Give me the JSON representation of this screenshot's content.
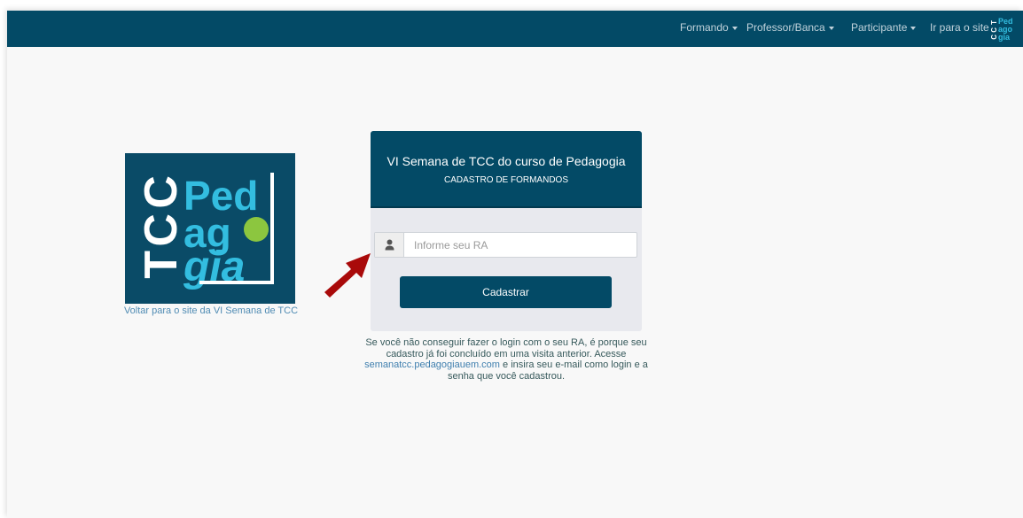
{
  "navbar": {
    "items": [
      {
        "label": "Formando",
        "has_dropdown": true
      },
      {
        "label": "Professor/Banca",
        "has_dropdown": true
      },
      {
        "label": "Participante",
        "has_dropdown": true
      },
      {
        "label": "Ir para o site",
        "has_dropdown": false
      }
    ],
    "logo_text": [
      "T",
      "C",
      "C",
      "Ped",
      "ago",
      "gia"
    ]
  },
  "logo": {
    "tcc_letters": [
      "T",
      "C",
      "C"
    ],
    "lines": [
      "Ped",
      "ag",
      "gia"
    ],
    "back_link": "Voltar para o site da VI Semana de TCC"
  },
  "card": {
    "title": "VI Semana de TCC do curso de Pedagogia",
    "subtitle": "CADASTRO DE FORMANDOS",
    "input_placeholder": "Informe seu RA",
    "input_value": "",
    "submit_label": "Cadastrar",
    "user_icon": "user-icon"
  },
  "help": {
    "text_before": "Se você não conseguir fazer o login com o seu RA, é porque seu cadastro já foi concluído em uma visita anterior. Acesse",
    "link": "semanatcc.pedagogiauem.com",
    "text_after": "e insira seu e-mail como login e a senha que você cadastrou."
  },
  "annotation": {
    "arrow_icon": "arrow-icon"
  },
  "colors": {
    "primary": "#034a66",
    "logo_cyan": "#33bde0",
    "logo_green": "#8cc63f",
    "arrow": "#a90a0a",
    "link": "#3f7fae"
  }
}
